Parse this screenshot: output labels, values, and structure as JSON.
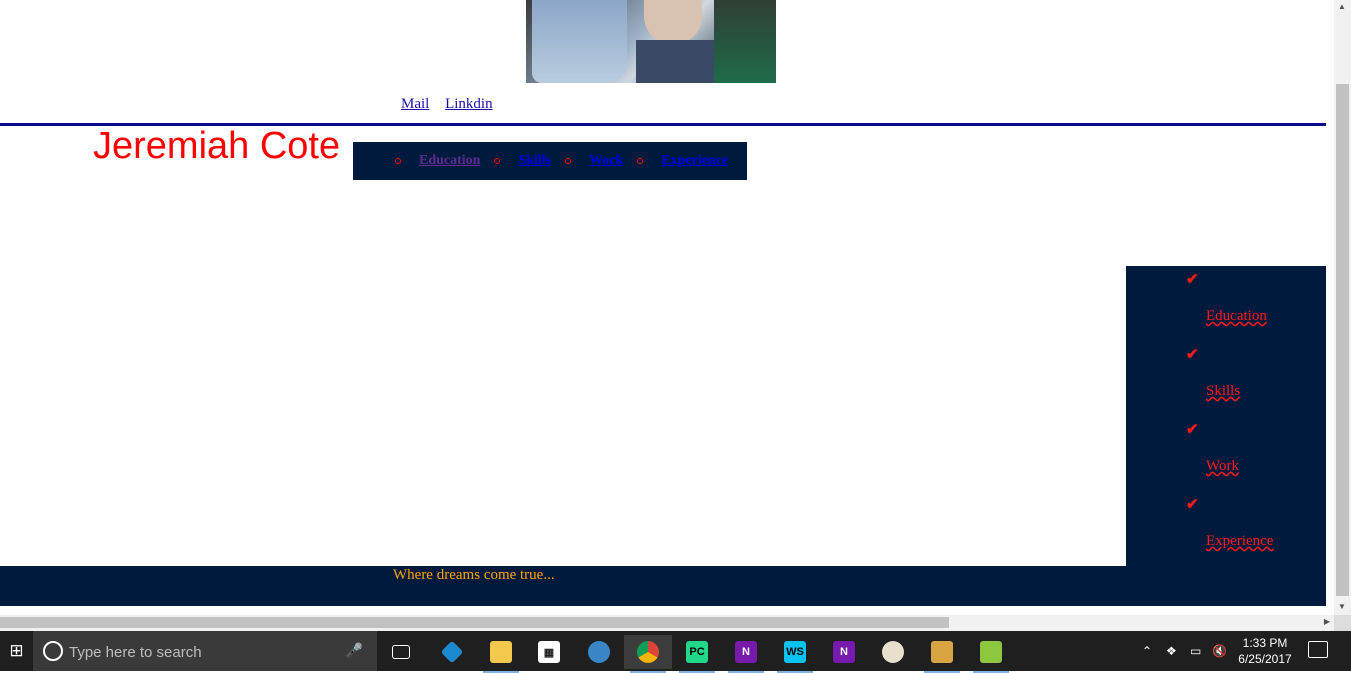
{
  "header": {
    "links": [
      "Mail",
      "Linkdin"
    ]
  },
  "profile": {
    "name": "Jeremiah Cote"
  },
  "top_nav": {
    "items": [
      "Education",
      "Skills",
      "Work",
      "Experience"
    ]
  },
  "side_nav": {
    "items": [
      "Education",
      "Skills",
      "Work",
      "Experience"
    ]
  },
  "footer": {
    "tagline": "Where dreams come true..."
  },
  "taskbar": {
    "search_placeholder": "Type here to search",
    "time": "1:33 PM",
    "date": "6/25/2017",
    "icons": [
      "task-view-icon",
      "kodi-icon",
      "file-explorer-icon",
      "store-icon",
      "thunderbird-icon",
      "chrome-icon",
      "pycharm-icon",
      "onenote-icon",
      "webstorm-icon",
      "onenote-2016-icon",
      "paint-icon",
      "file-manager-icon",
      "notepad-plus-icon"
    ]
  },
  "colors": {
    "navy": "#001a3d",
    "name_red": "#ff0000",
    "tagline_orange": "#ffa500",
    "rule_blue": "#0a0a8c"
  }
}
